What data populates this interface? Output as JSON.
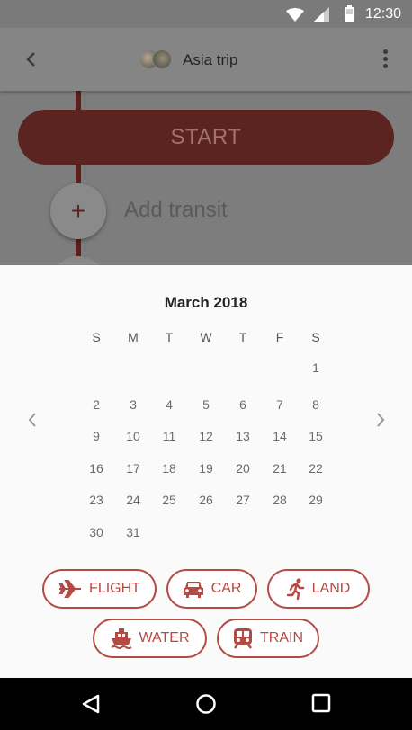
{
  "status_bar": {
    "time": "12:30",
    "icons": [
      "wifi-icon",
      "signal-icon",
      "battery-icon"
    ],
    "bg_color": "#7a7a7a"
  },
  "toolbar": {
    "title": "Asia trip",
    "back_icon": "chevron-left-icon",
    "more_icon": "more-vert-icon"
  },
  "timeline": {
    "start_label": "START",
    "add_transit_label": "Add transit",
    "add_icon": "plus-icon"
  },
  "calendar": {
    "month": "March 2018",
    "weekdays": [
      "S",
      "M",
      "T",
      "W",
      "T",
      "F",
      "S"
    ],
    "days": [
      "1",
      "2",
      "3",
      "4",
      "5",
      "6",
      "7",
      "8",
      "9",
      "10",
      "11",
      "12",
      "13",
      "14",
      "15",
      "16",
      "17",
      "18",
      "19",
      "20",
      "21",
      "22",
      "23",
      "24",
      "25",
      "26",
      "27",
      "28",
      "29",
      "30",
      "31"
    ],
    "prev_icon": "chevron-left-icon",
    "next_icon": "chevron-right-icon"
  },
  "transport_options": [
    {
      "label": "FLIGHT",
      "icon": "airplane-icon"
    },
    {
      "label": "CAR",
      "icon": "car-icon"
    },
    {
      "label": "LAND",
      "icon": "running-person-icon"
    },
    {
      "label": "WATER",
      "icon": "ferry-icon"
    },
    {
      "label": "TRAIN",
      "icon": "train-icon"
    }
  ],
  "colors": {
    "accent": "#b54a44",
    "start_button": "#5b2420",
    "scrim": "#7d7d7d"
  },
  "nav_bar": {
    "icons": [
      "back-triangle-icon",
      "home-circle-icon",
      "recents-square-icon"
    ]
  }
}
